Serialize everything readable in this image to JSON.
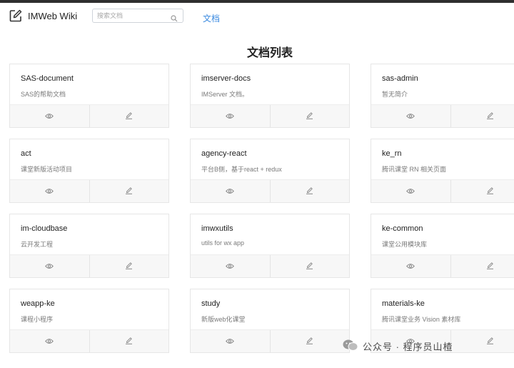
{
  "header": {
    "brand_name": "IMWeb Wiki",
    "search_placeholder": "搜索文档",
    "nav_link": "文档"
  },
  "page": {
    "title": "文档列表"
  },
  "docs": [
    {
      "name": "SAS-document",
      "desc": "SAS的帮助文档"
    },
    {
      "name": "imserver-docs",
      "desc": "IMServer 文档。"
    },
    {
      "name": "sas-admin",
      "desc": "暂无简介"
    },
    {
      "name": "act",
      "desc": "课堂新版活动项目"
    },
    {
      "name": "agency-react",
      "desc": "平台B侧，基于react + redux"
    },
    {
      "name": "ke_rn",
      "desc": "腾讯课堂 RN 相关页面"
    },
    {
      "name": "im-cloudbase",
      "desc": "云开发工程"
    },
    {
      "name": "imwxutils",
      "desc": "utils for wx app"
    },
    {
      "name": "ke-common",
      "desc": "课堂公用模块库"
    },
    {
      "name": "weapp-ke",
      "desc": "课程小程序"
    },
    {
      "name": "study",
      "desc": "新版web化课堂"
    },
    {
      "name": "materials-ke",
      "desc": "腾讯课堂业务 Vision 素材库"
    }
  ],
  "watermark": {
    "text": "公众号 · 程序员山楂"
  },
  "colors": {
    "accent": "#3c8be0",
    "icon": "#888888",
    "topbar": "#2f2f2f"
  },
  "icons": {
    "view": "eye-icon",
    "edit": "pencil-icon",
    "search": "search-icon",
    "brand": "edit-square-icon"
  }
}
